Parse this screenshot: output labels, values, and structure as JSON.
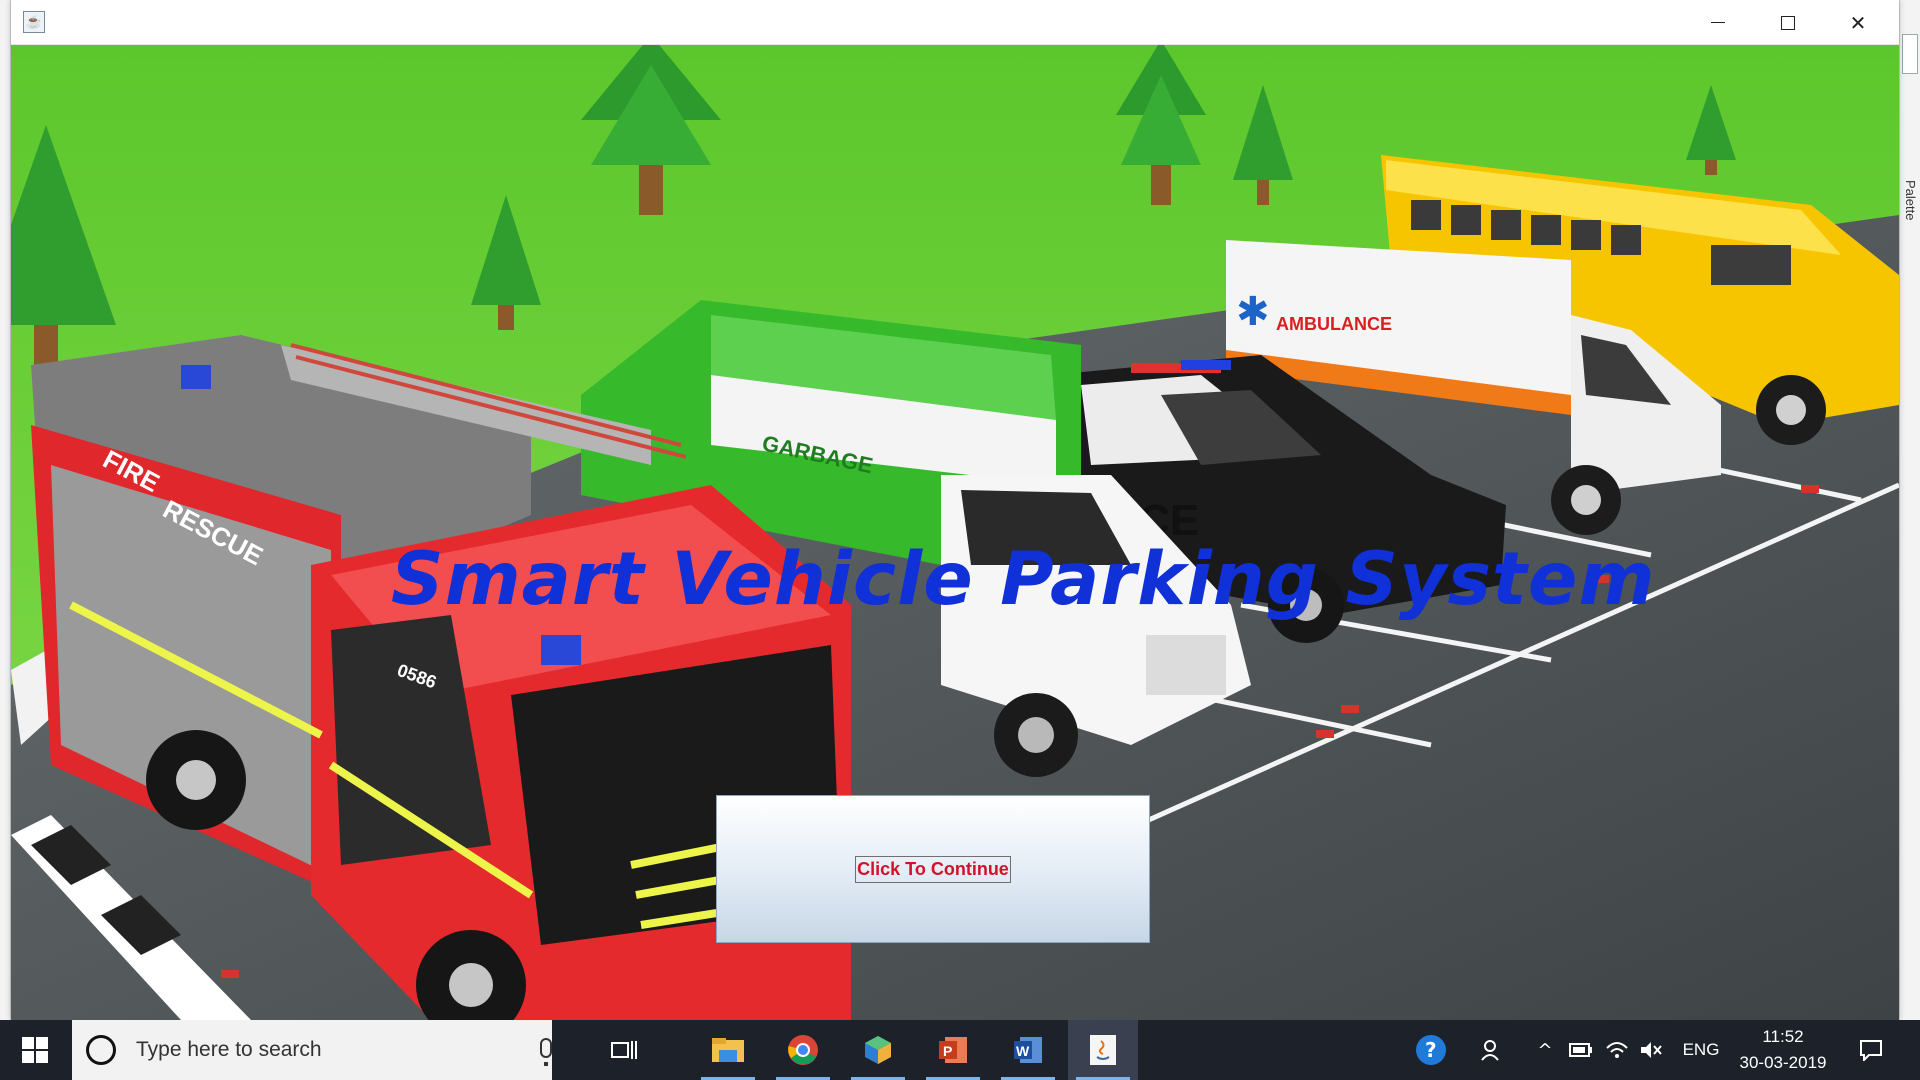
{
  "window": {
    "title": "",
    "app_icon": "java-cup-icon",
    "controls": {
      "minimize": "minimize-icon",
      "maximize": "maximize-icon",
      "close": "close-icon"
    }
  },
  "ide_side": {
    "palette_label": "Palette"
  },
  "main": {
    "heading": "Smart Vehicle Parking System",
    "continue_button": "Click To Continue",
    "scene_vehicles": [
      "FIRE RESCUE",
      "GARBAGE",
      "POLICE",
      "AMBULANCE",
      "SCHOOL BUS"
    ],
    "vehicle_labels": {
      "fire_side": "FIRE",
      "fire_side2": "RESCUE",
      "fire_num": "0586",
      "garbage": "GARBAGE",
      "police": "ICE",
      "ambulance": "AMBULANCE"
    }
  },
  "taskbar": {
    "search_placeholder": "Type here to search",
    "apps": [
      "file-explorer-icon",
      "chrome-icon",
      "box-app-icon",
      "powerpoint-icon",
      "word-icon",
      "java-icon"
    ],
    "active_app": "java-icon",
    "tray": {
      "language": "ENG",
      "time": "11:52",
      "date": "30-03-2019"
    }
  },
  "colors": {
    "heading": "#1030d8",
    "continue_text": "#d4102a",
    "grass": "#6ecf3a",
    "asphalt": "#505658",
    "taskbar": "#1d2129"
  }
}
